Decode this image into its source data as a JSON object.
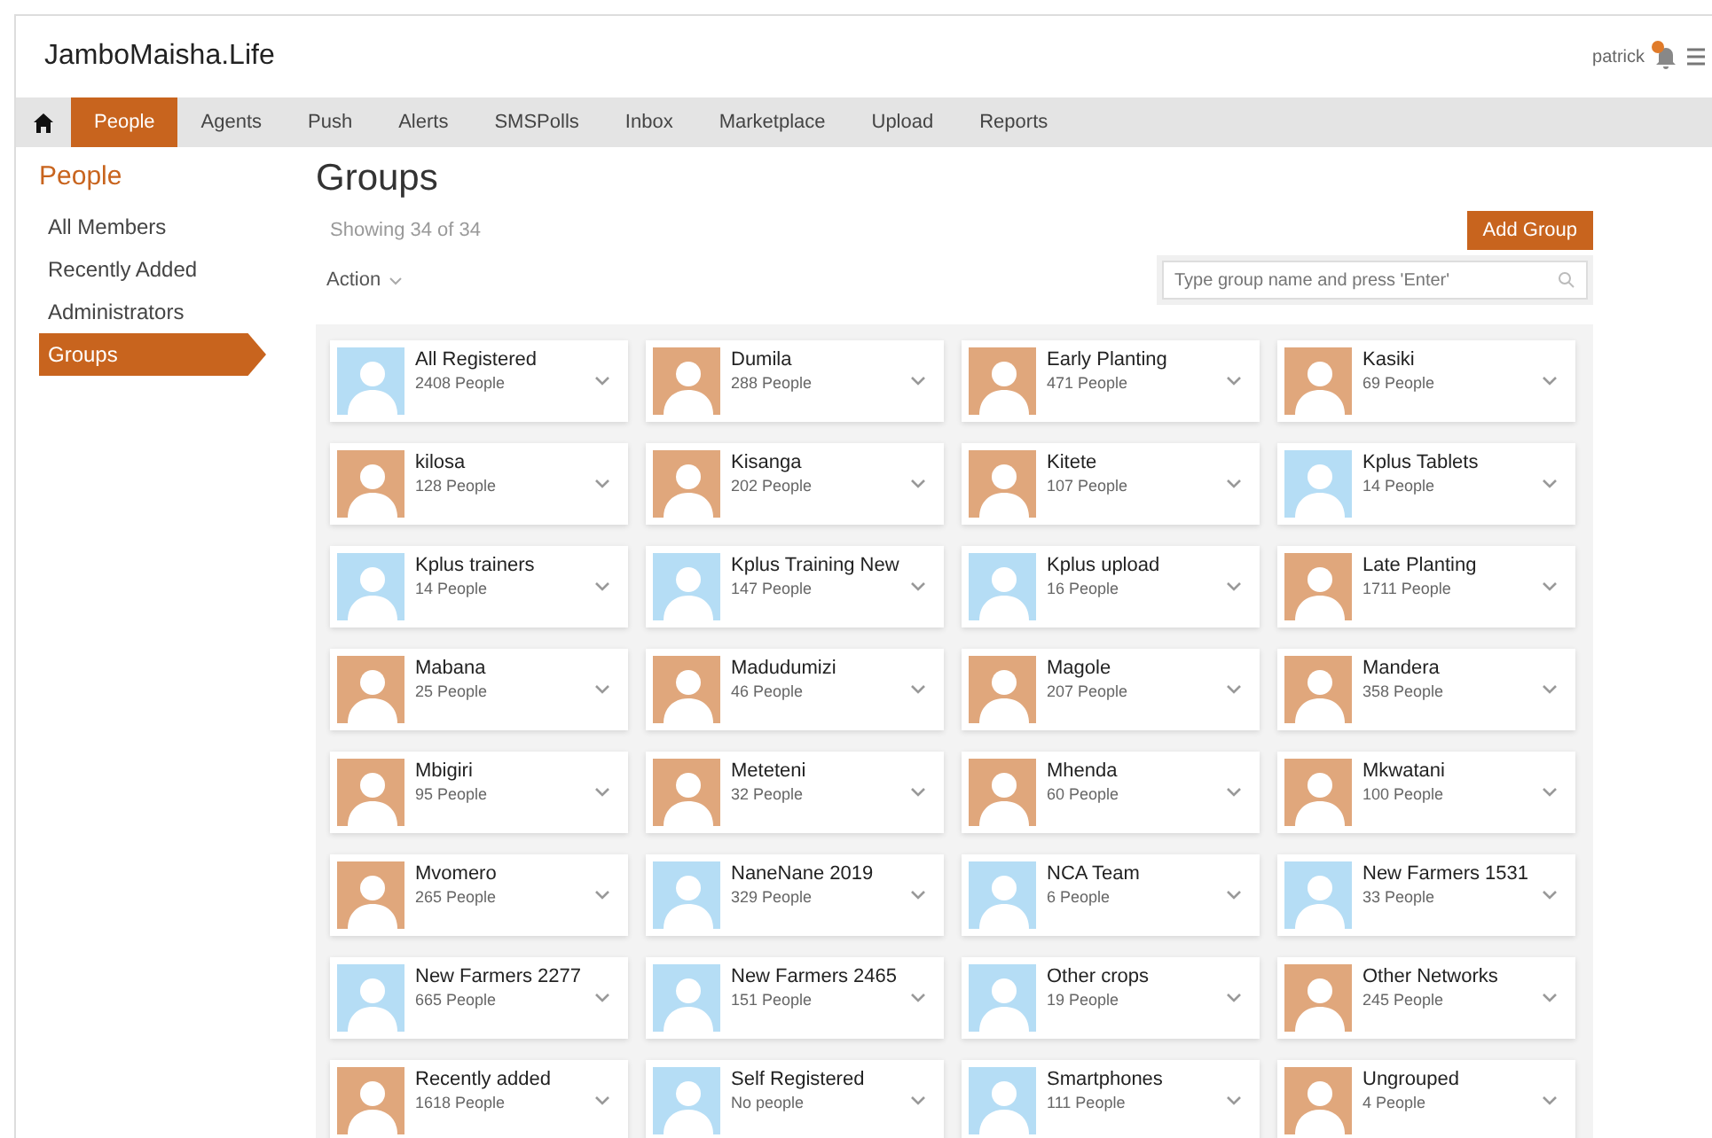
{
  "brand": "JamboMaisha.Life",
  "user": "patrick",
  "nav": [
    {
      "label": "People",
      "selected": true
    },
    {
      "label": "Agents",
      "selected": false
    },
    {
      "label": "Push",
      "selected": false
    },
    {
      "label": "Alerts",
      "selected": false
    },
    {
      "label": "SMSPolls",
      "selected": false
    },
    {
      "label": "Inbox",
      "selected": false
    },
    {
      "label": "Marketplace",
      "selected": false
    },
    {
      "label": "Upload",
      "selected": false
    },
    {
      "label": "Reports",
      "selected": false
    }
  ],
  "sidebar": {
    "title": "People",
    "items": [
      {
        "label": "All Members",
        "selected": false
      },
      {
        "label": "Recently Added",
        "selected": false
      },
      {
        "label": "Administrators",
        "selected": false
      },
      {
        "label": "Groups",
        "selected": true
      }
    ]
  },
  "page_title": "Groups",
  "showing": "Showing 34 of 34",
  "add_button": "Add Group",
  "action": "Action",
  "search": {
    "placeholder": "Type group name and press 'Enter'"
  },
  "groups": [
    {
      "name": "All Registered",
      "count": "2408 People",
      "color": "#b5ddf5"
    },
    {
      "name": "Dumila",
      "count": "288 People",
      "color": "#e0a77c"
    },
    {
      "name": "Early Planting",
      "count": "471 People",
      "color": "#e0a77c"
    },
    {
      "name": "Kasiki",
      "count": "69 People",
      "color": "#e0a77c"
    },
    {
      "name": "kilosa",
      "count": "128 People",
      "color": "#e0a77c"
    },
    {
      "name": "Kisanga",
      "count": "202 People",
      "color": "#e0a77c"
    },
    {
      "name": "Kitete",
      "count": "107 People",
      "color": "#e0a77c"
    },
    {
      "name": "Kplus Tablets",
      "count": "14 People",
      "color": "#b5ddf5"
    },
    {
      "name": "Kplus trainers",
      "count": "14 People",
      "color": "#b5ddf5"
    },
    {
      "name": "Kplus Training New",
      "count": "147 People",
      "color": "#b5ddf5"
    },
    {
      "name": "Kplus upload",
      "count": "16 People",
      "color": "#b5ddf5"
    },
    {
      "name": "Late Planting",
      "count": "1711 People",
      "color": "#e0a77c"
    },
    {
      "name": "Mabana",
      "count": "25 People",
      "color": "#e0a77c"
    },
    {
      "name": "Madudumizi",
      "count": "46 People",
      "color": "#e0a77c"
    },
    {
      "name": "Magole",
      "count": "207 People",
      "color": "#e0a77c"
    },
    {
      "name": "Mandera",
      "count": "358 People",
      "color": "#e0a77c"
    },
    {
      "name": "Mbigiri",
      "count": "95 People",
      "color": "#e0a77c"
    },
    {
      "name": "Meteteni",
      "count": "32 People",
      "color": "#e0a77c"
    },
    {
      "name": "Mhenda",
      "count": "60 People",
      "color": "#e0a77c"
    },
    {
      "name": "Mkwatani",
      "count": "100 People",
      "color": "#e0a77c"
    },
    {
      "name": "Mvomero",
      "count": "265 People",
      "color": "#e0a77c"
    },
    {
      "name": "NaneNane 2019",
      "count": "329 People",
      "color": "#b5ddf5"
    },
    {
      "name": "NCA Team",
      "count": "6 People",
      "color": "#b5ddf5"
    },
    {
      "name": "New Farmers 1531",
      "count": "33 People",
      "color": "#b5ddf5"
    },
    {
      "name": "New Farmers 2277",
      "count": "665 People",
      "color": "#b5ddf5"
    },
    {
      "name": "New Farmers 2465",
      "count": "151 People",
      "color": "#b5ddf5"
    },
    {
      "name": "Other crops",
      "count": "19 People",
      "color": "#b5ddf5"
    },
    {
      "name": "Other Networks",
      "count": "245 People",
      "color": "#e0a77c"
    },
    {
      "name": "Recently added",
      "count": "1618 People",
      "color": "#e0a77c"
    },
    {
      "name": "Self Registered",
      "count": "No people",
      "color": "#b5ddf5"
    },
    {
      "name": "Smartphones",
      "count": "111 People",
      "color": "#b5ddf5"
    },
    {
      "name": "Ungrouped",
      "count": "4 People",
      "color": "#e0a77c"
    }
  ]
}
